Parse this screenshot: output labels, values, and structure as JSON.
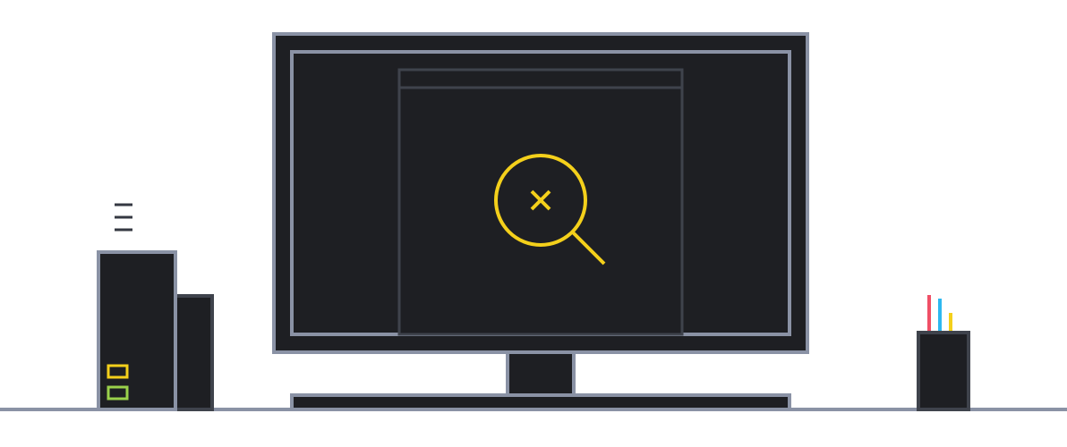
{
  "illustration": {
    "colors": {
      "background": "#ffffff",
      "dark": "#1e1f23",
      "outline": "#8a92a5",
      "inner_outline": "#3f434c",
      "accent_yellow": "#f4d01b",
      "accent_green": "#9ad14b",
      "accent_red": "#f04f66",
      "accent_blue": "#2eb8f0",
      "floor": "#8a92a5",
      "stack_lines": "#353842"
    },
    "icons": {
      "monitor": "desktop-monitor-icon",
      "search_error": "magnifier-x-icon",
      "speaker": "speaker-tower-icon",
      "pen_holder": "pen-holder-icon"
    }
  }
}
